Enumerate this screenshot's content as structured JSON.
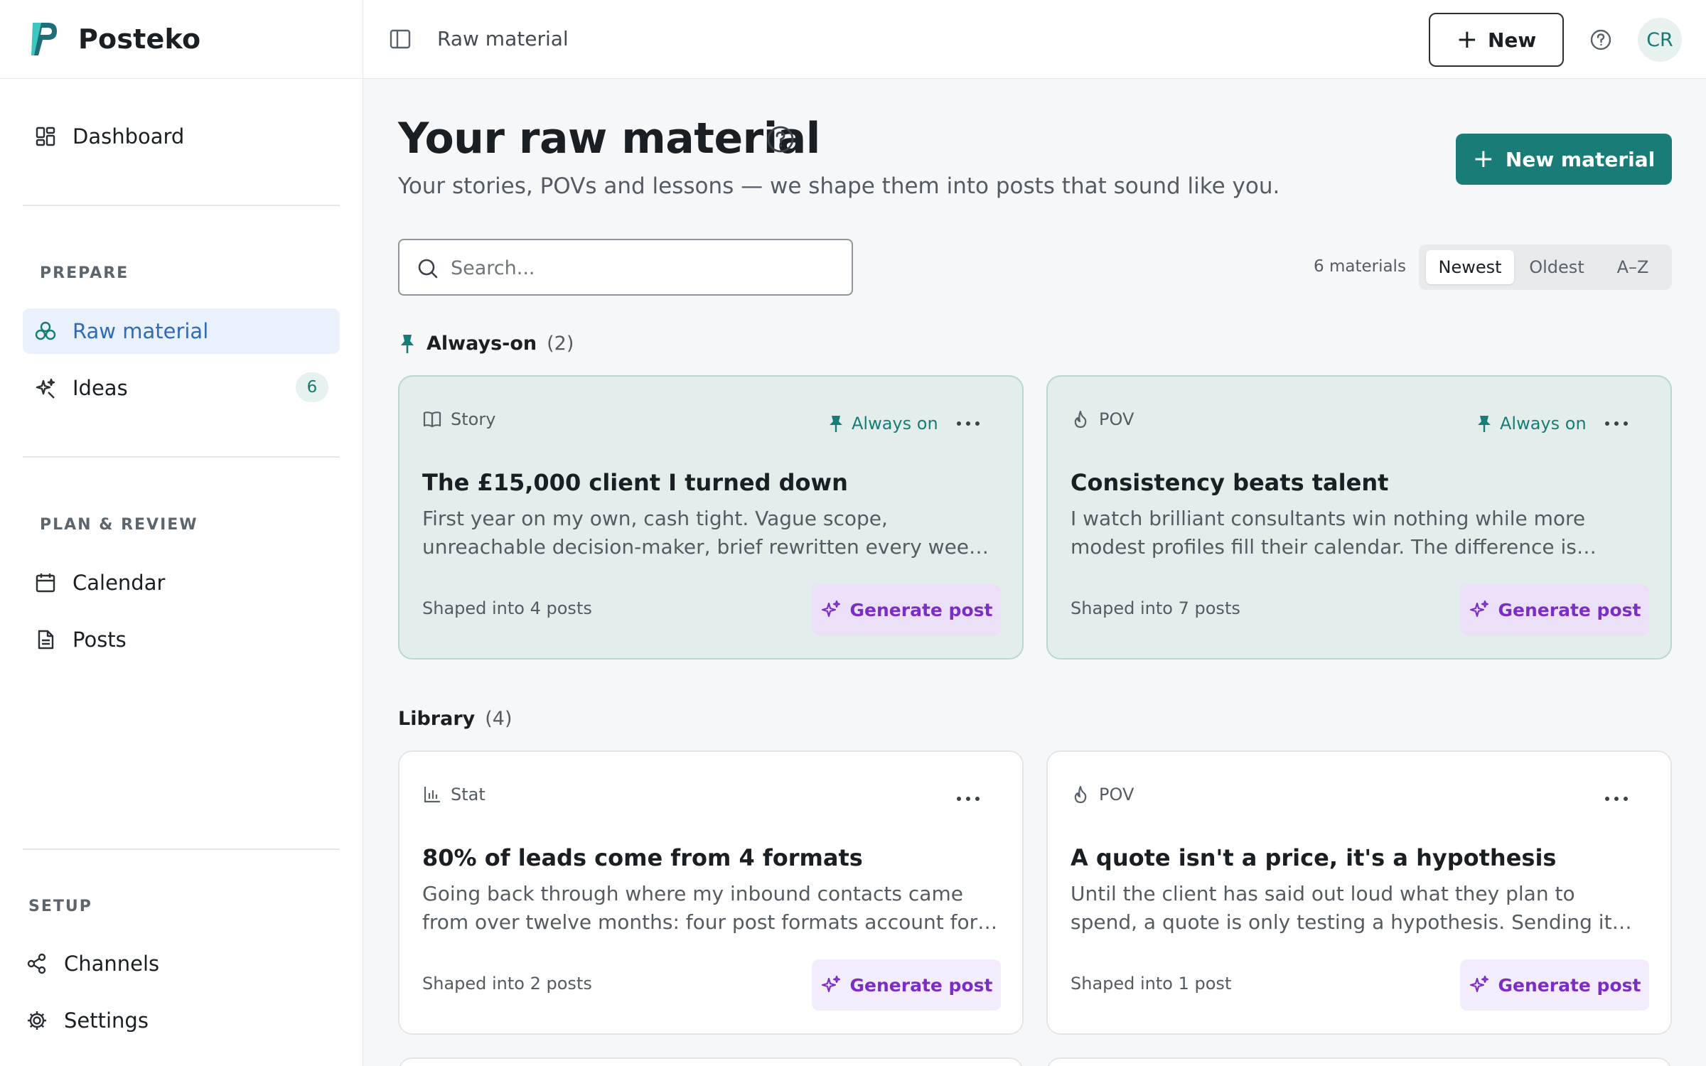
{
  "app": {
    "name": "Posteko"
  },
  "sidebar": {
    "dashboard": "Dashboard",
    "prepare_label": "PREPARE",
    "raw_material": "Raw material",
    "ideas": "Ideas",
    "ideas_count": "6",
    "plan_label": "PLAN & REVIEW",
    "calendar": "Calendar",
    "posts": "Posts",
    "setup_label": "SETUP",
    "channels": "Channels",
    "settings": "Settings"
  },
  "topbar": {
    "breadcrumb": "Raw material",
    "new_label": "New",
    "avatar_initials": "CR"
  },
  "header": {
    "title": "Your raw material",
    "subtitle": "Your stories, POVs and lessons — we shape them into posts that sound like you.",
    "new_material_label": "New material"
  },
  "search": {
    "placeholder": "Search..."
  },
  "toolbar": {
    "count": "6 materials",
    "sort_options": [
      "Newest",
      "Oldest",
      "A–Z"
    ],
    "sort_selected": "Newest"
  },
  "sections": {
    "always_on": {
      "title": "Always-on",
      "count": "(2)"
    },
    "library": {
      "title": "Library",
      "count": "(4)"
    }
  },
  "common": {
    "always_on_label": "Always on",
    "generate_label": "Generate post"
  },
  "cards": [
    {
      "type": "Story",
      "icon": "book-icon",
      "pinned": true,
      "title": "The £15,000 client I turned down",
      "excerpt": "First year on my own, cash tight. Vague scope, unreachable decision-maker, brief rewritten every week. I said no. The three months that followed were the best of the year.",
      "shaped": "Shaped into 4 posts"
    },
    {
      "type": "POV",
      "icon": "flame-icon",
      "pinned": true,
      "title": "Consistency beats talent",
      "excerpt": "I watch brilliant consultants win nothing while more modest profiles fill their calendar. The difference is almost never skill: it's showing up, week after week.",
      "shaped": "Shaped into 7 posts"
    },
    {
      "type": "Stat",
      "icon": "bar-chart-icon",
      "pinned": false,
      "title": "80% of leads come from 4 formats",
      "excerpt": "Going back through where my inbound contacts came from over twelve months: four post formats account for nearly all of them, and the rest barely register.",
      "shaped": "Shaped into 2 posts"
    },
    {
      "type": "POV",
      "icon": "flame-icon",
      "pinned": false,
      "title": "A quote isn't a price, it's a hypothesis",
      "excerpt": "Until the client has said out loud what they plan to spend, a quote is only testing a hypothesis. Sending it too early turns the conversation into a bargain.",
      "shaped": "Shaped into 1 post"
    }
  ],
  "colors": {
    "accent": "#1a7c76",
    "active_nav": "#2f6bb8",
    "generate": "#7a2fc2",
    "pinned_card": "#e3eeec"
  }
}
